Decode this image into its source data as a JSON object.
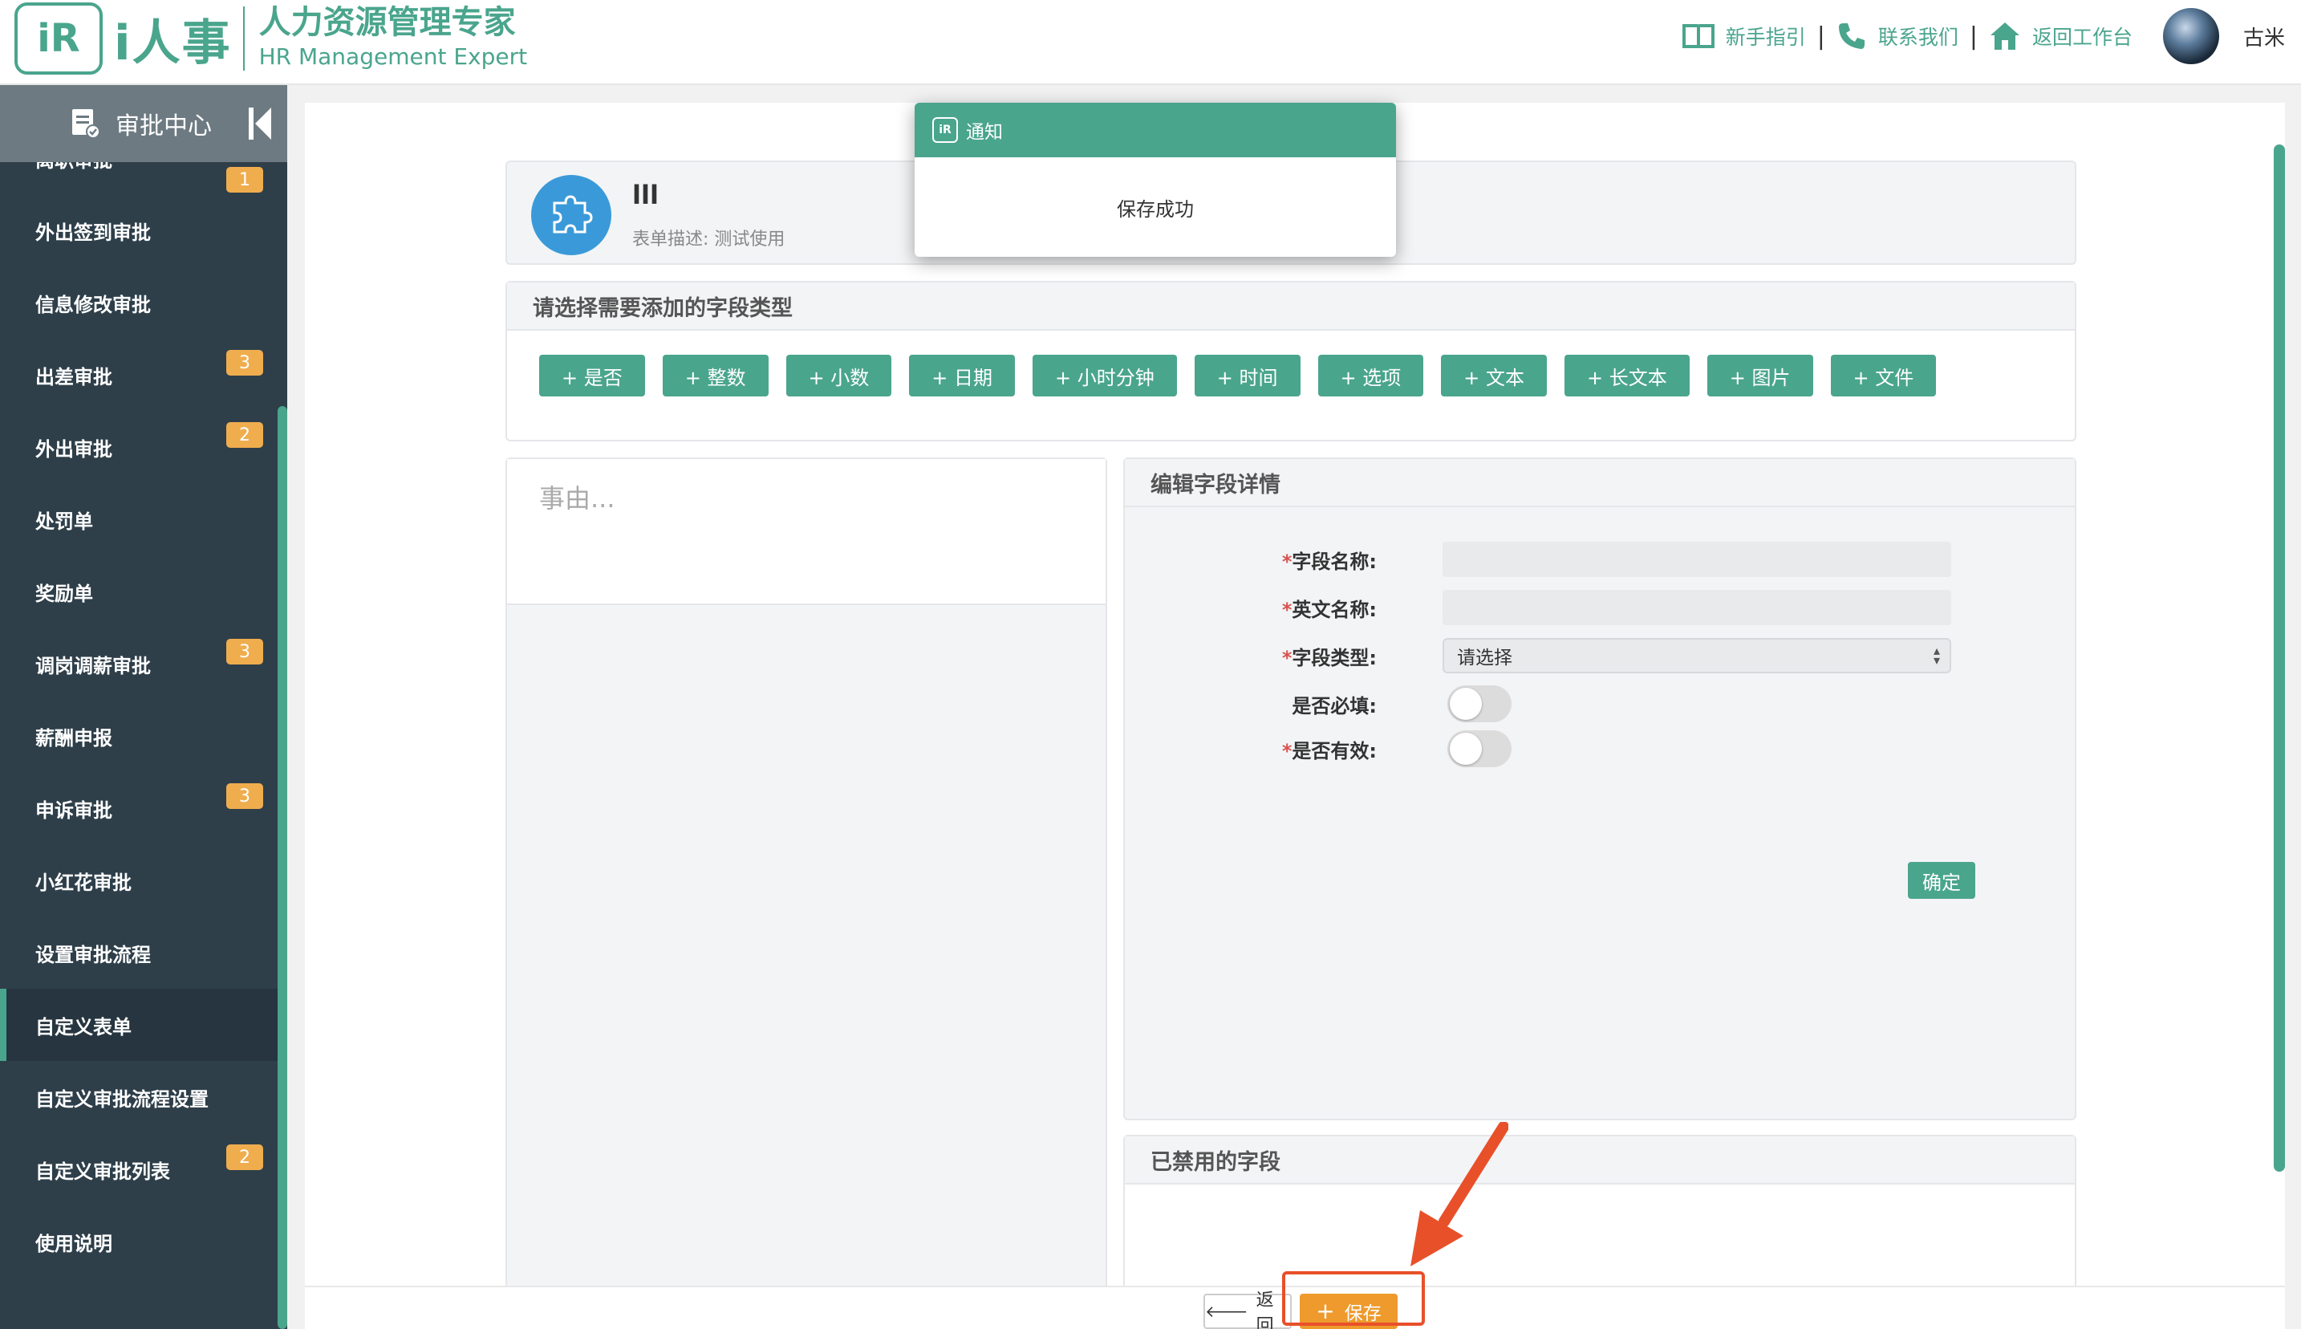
{
  "header": {
    "logo_mark": "iR",
    "logo_name": "i人事",
    "logo_title_cn": "人力资源管理专家",
    "logo_title_en": "HR Management Expert",
    "links": [
      "新手指引",
      "联系我们",
      "返回工作台"
    ],
    "separator": "|",
    "username": "古米"
  },
  "sidebar": {
    "title": "审批中心",
    "items": [
      {
        "label": "离职审批",
        "badge": "1"
      },
      {
        "label": "外出签到审批",
        "badge": ""
      },
      {
        "label": "信息修改审批",
        "badge": ""
      },
      {
        "label": "出差审批",
        "badge": "3"
      },
      {
        "label": "外出审批",
        "badge": "2"
      },
      {
        "label": "处罚单",
        "badge": ""
      },
      {
        "label": "奖励单",
        "badge": ""
      },
      {
        "label": "调岗调薪审批",
        "badge": "3"
      },
      {
        "label": "薪酬申报",
        "badge": ""
      },
      {
        "label": "申诉审批",
        "badge": "3"
      },
      {
        "label": "小红花审批",
        "badge": ""
      },
      {
        "label": "设置审批流程",
        "badge": ""
      },
      {
        "label": "自定义表单",
        "badge": ""
      },
      {
        "label": "自定义审批流程设置",
        "badge": ""
      },
      {
        "label": "自定义审批列表",
        "badge": "2"
      },
      {
        "label": "使用说明",
        "badge": ""
      }
    ],
    "active_index": 12
  },
  "form": {
    "title": "lll",
    "desc": "表单描述:  测试使用"
  },
  "field_types": {
    "heading": "请选择需要添加的字段类型",
    "buttons": [
      "+ 是否",
      "+ 整数",
      "+ 小数",
      "+ 日期",
      "+ 小时分钟",
      "+ 时间",
      "+ 选项",
      "+ 文本",
      "+ 长文本",
      "+ 图片",
      "+ 文件"
    ]
  },
  "preview": {
    "placeholder": "事由..."
  },
  "edit": {
    "heading": "编辑字段详情",
    "required_mark": "*",
    "field_name_label": "字段名称:",
    "en_name_label": "英文名称:",
    "type_label": "字段类型:",
    "type_value": "请选择",
    "required_label": "是否必填:",
    "valid_label": "是否有效:",
    "ok": "确定"
  },
  "disabled_fields": {
    "heading": "已禁用的字段"
  },
  "footer": {
    "back": "返回",
    "save": "保存"
  },
  "toast": {
    "title": "通知",
    "message": "保存成功"
  },
  "colors": {
    "brand": "#4aa58d",
    "sidebar": "#2e3f4a",
    "badge": "#f0ad4e",
    "save": "#ee9a2c",
    "annotation": "#e8502a"
  }
}
